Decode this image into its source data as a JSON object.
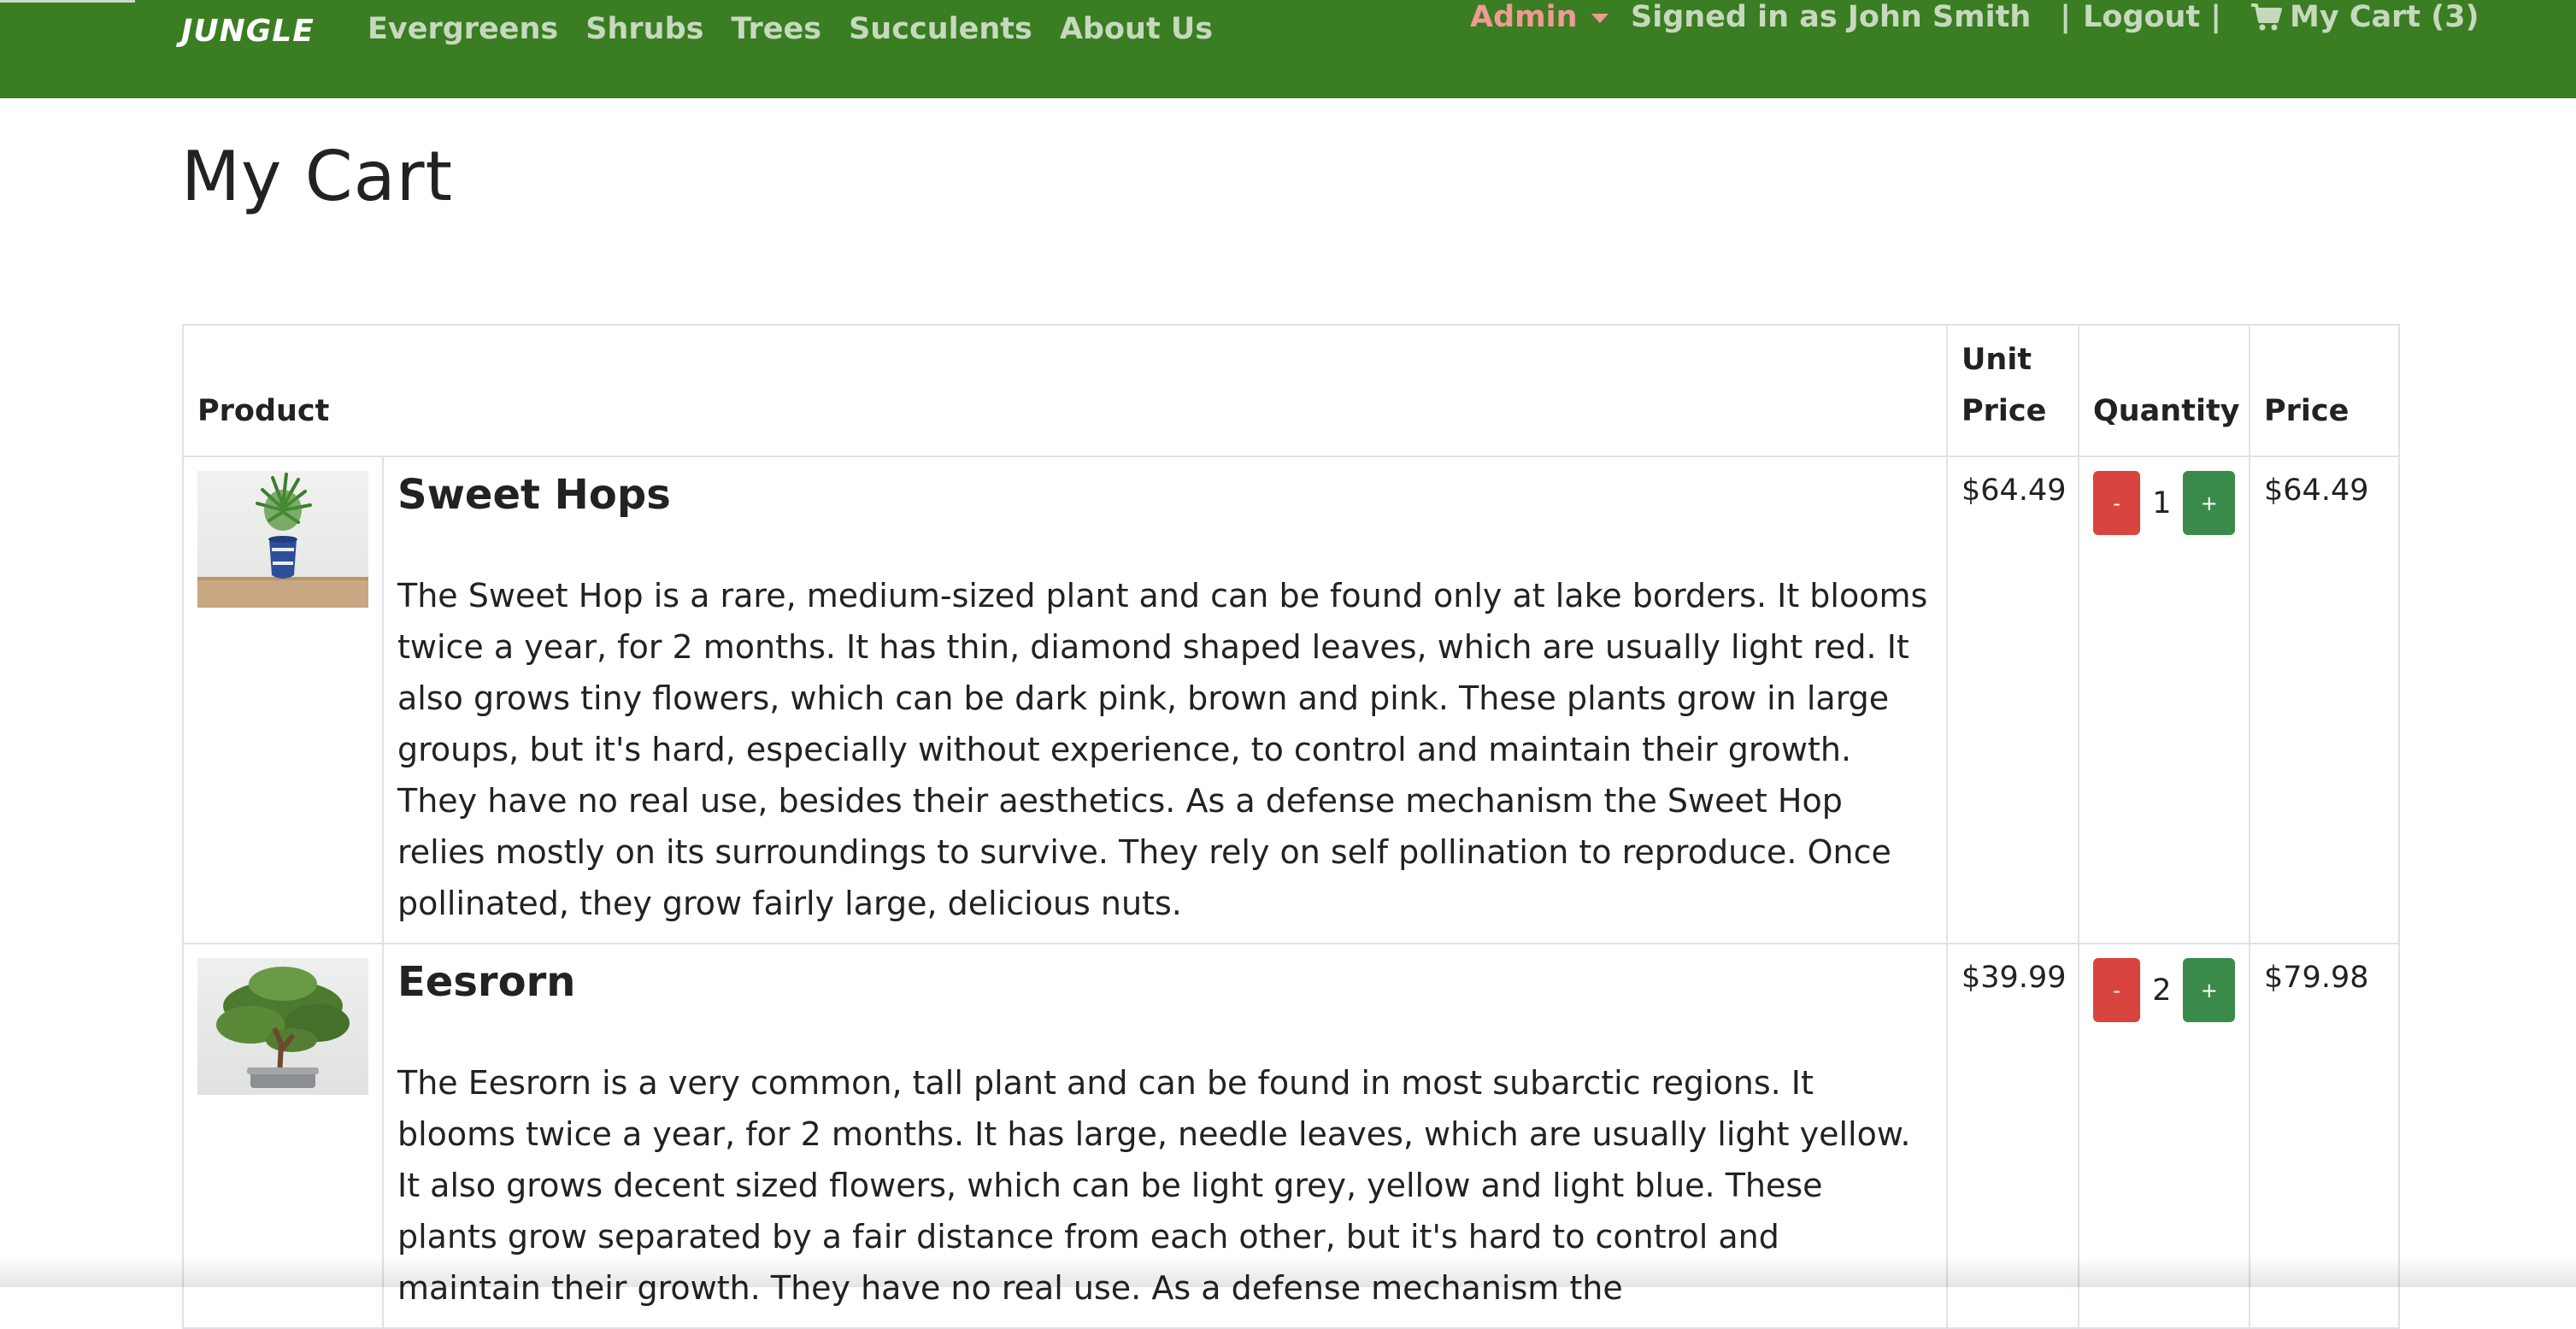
{
  "navbar": {
    "brand": "JUNGLE",
    "links": [
      "Evergreens",
      "Shrubs",
      "Trees",
      "Succulents",
      "About Us"
    ],
    "admin_label": "Admin",
    "signed_in_text": "Signed in as John Smith",
    "separator": "|",
    "logout_label": "Logout",
    "cart_label": "My Cart (3)",
    "colors": {
      "background": "#3a7d23",
      "link": "#c6d9bd",
      "admin": "#f09a92"
    }
  },
  "page": {
    "title": "My Cart"
  },
  "table": {
    "headers": {
      "product": "Product",
      "unit_price": "Unit Price",
      "quantity": "Quantity",
      "price": "Price"
    },
    "rows": [
      {
        "name": "Sweet Hops",
        "description": "The Sweet Hop is a rare, medium-sized plant and can be found only at lake borders. It blooms twice a year, for 2 months. It has thin, diamond shaped leaves, which are usually light red. It also grows tiny flowers, which can be dark pink, brown and pink. These plants grow in large groups, but it's hard, especially without experience, to control and maintain their growth. They have no real use, besides their aesthetics. As a defense mechanism the Sweet Hop relies mostly on its surroundings to survive. They rely on self pollination to reproduce. Once pollinated, they grow fairly large, delicious nuts.",
        "unit_price": "$64.49",
        "quantity": "1",
        "price": "$64.49",
        "minus_label": "-",
        "plus_label": "+"
      },
      {
        "name": "Eesrorn",
        "description": "The Eesrorn is a very common, tall plant and can be found in most subarctic regions. It blooms twice a year, for 2 months. It has large, needle leaves, which are usually light yellow. It also grows decent sized flowers, which can be light grey, yellow and light blue. These plants grow separated by a fair distance from each other, but it's hard to control and maintain their growth. They have no real use. As a defense mechanism the",
        "unit_price": "$39.99",
        "quantity": "2",
        "price": "$79.98",
        "minus_label": "-",
        "plus_label": "+"
      }
    ]
  },
  "icons": {
    "cart": "shopping-cart-icon",
    "dropdown": "caret-down-icon"
  },
  "button_colors": {
    "minus": "#d9443f",
    "plus": "#3a8b49"
  }
}
